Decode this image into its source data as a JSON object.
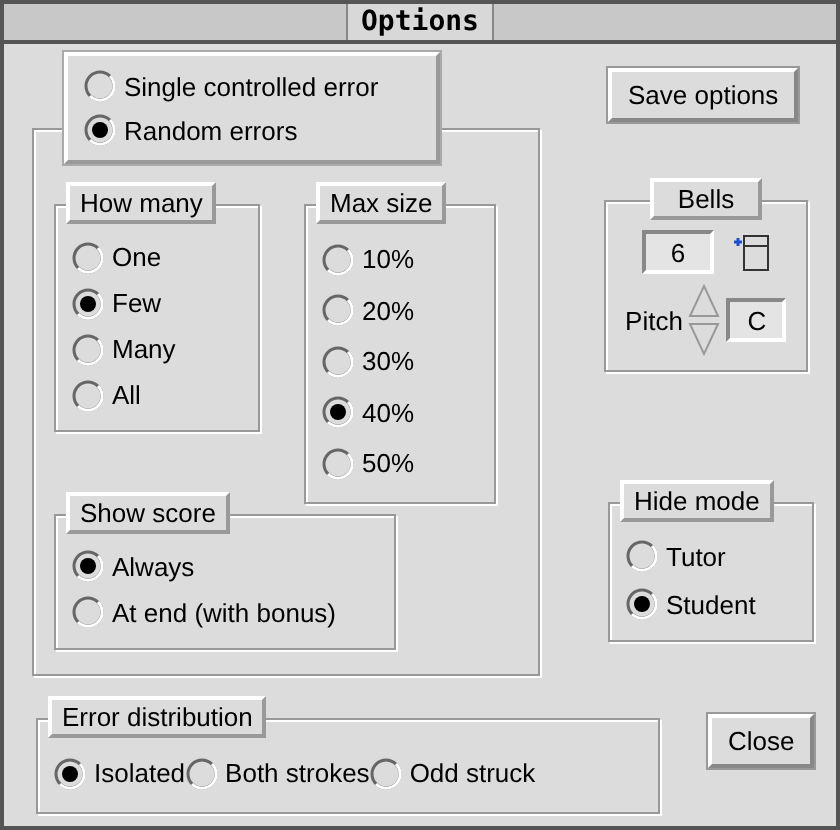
{
  "window": {
    "title": "Options"
  },
  "error_mode": [
    {
      "label": "Single controlled error",
      "selected": false
    },
    {
      "label": "Random errors",
      "selected": true
    }
  ],
  "how_many": {
    "label": "How many",
    "options": [
      {
        "label": "One",
        "selected": false
      },
      {
        "label": "Few",
        "selected": true
      },
      {
        "label": "Many",
        "selected": false
      },
      {
        "label": "All",
        "selected": false
      }
    ]
  },
  "max_size": {
    "label": "Max size",
    "options": [
      {
        "label": "10%",
        "selected": false
      },
      {
        "label": "20%",
        "selected": false
      },
      {
        "label": "30%",
        "selected": false
      },
      {
        "label": "40%",
        "selected": true
      },
      {
        "label": "50%",
        "selected": false
      }
    ]
  },
  "show_score": {
    "label": "Show score",
    "options": [
      {
        "label": "Always",
        "selected": true
      },
      {
        "label": "At end (with bonus)",
        "selected": false
      }
    ]
  },
  "bells": {
    "label": "Bells",
    "value": "6",
    "pitch_label": "Pitch",
    "pitch": "C"
  },
  "hide_mode": {
    "label": "Hide mode",
    "options": [
      {
        "label": "Tutor",
        "selected": false
      },
      {
        "label": "Student",
        "selected": true
      }
    ]
  },
  "error_distribution": {
    "label": "Error distribution",
    "options": [
      {
        "label": "Isolated",
        "selected": true
      },
      {
        "label": "Both strokes",
        "selected": false
      },
      {
        "label": "Odd struck",
        "selected": false
      }
    ]
  },
  "buttons": [
    {
      "label": "Save options"
    },
    {
      "label": "Close"
    }
  ]
}
